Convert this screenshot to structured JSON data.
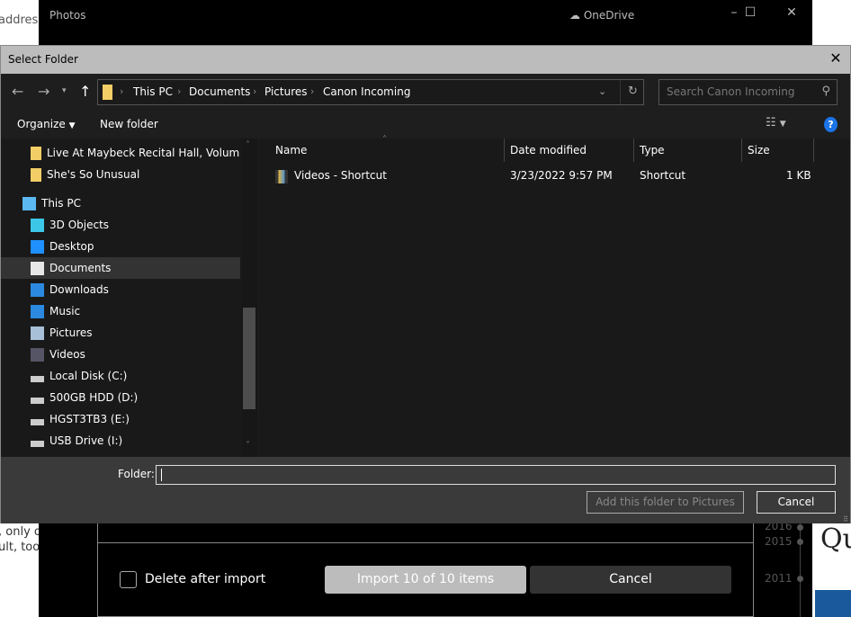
{
  "background": {
    "browser_snippets": [
      "address b",
      ", only o",
      "ult, too."
    ],
    "right_text": "Qu"
  },
  "photos": {
    "title": "Photos",
    "onedrive": "OneDrive",
    "timeline_years": [
      "2016",
      "2015",
      "2011"
    ],
    "delete_after_import": {
      "label": "Delete after import",
      "checked": false
    },
    "import_button": "Import 10 of 10 items",
    "cancel_button": "Cancel"
  },
  "dialog": {
    "title": "Select Folder",
    "breadcrumb": [
      "This PC",
      "Documents",
      "Pictures",
      "Canon Incoming"
    ],
    "search_placeholder": "Search Canon Incoming",
    "toolbar": {
      "organize": "Organize",
      "new_folder": "New folder"
    },
    "nav_items": [
      {
        "label": "Live At Maybeck Recital Hall, Volume Nine",
        "icon": "folder-icon",
        "indent": 2
      },
      {
        "label": "She's So Unusual",
        "icon": "folder-icon",
        "indent": 2
      },
      {
        "label": "This PC",
        "icon": "computer-icon",
        "indent": 1
      },
      {
        "label": "3D Objects",
        "icon": "cube-icon",
        "indent": 2
      },
      {
        "label": "Desktop",
        "icon": "desktop-icon",
        "indent": 2
      },
      {
        "label": "Documents",
        "icon": "document-icon",
        "indent": 2,
        "selected": true
      },
      {
        "label": "Downloads",
        "icon": "download-icon",
        "indent": 2
      },
      {
        "label": "Music",
        "icon": "music-icon",
        "indent": 2
      },
      {
        "label": "Pictures",
        "icon": "pictures-icon",
        "indent": 2
      },
      {
        "label": "Videos",
        "icon": "videos-icon",
        "indent": 2
      },
      {
        "label": "Local Disk (C:)",
        "icon": "system-drive-icon",
        "indent": 2
      },
      {
        "label": "500GB HDD (D:)",
        "icon": "drive-icon",
        "indent": 2
      },
      {
        "label": "HGST3TB3 (E:)",
        "icon": "drive-icon",
        "indent": 2
      },
      {
        "label": "USB Drive (I:)",
        "icon": "drive-icon",
        "indent": 2
      }
    ],
    "columns": [
      "Name",
      "Date modified",
      "Type",
      "Size"
    ],
    "files": [
      {
        "name": "Videos - Shortcut",
        "date": "3/23/2022 9:57 PM",
        "type": "Shortcut",
        "size": "1 KB"
      }
    ],
    "folder_label": "Folder:",
    "folder_value": "",
    "add_button": "Add this folder to Pictures",
    "cancel_button": "Cancel"
  }
}
